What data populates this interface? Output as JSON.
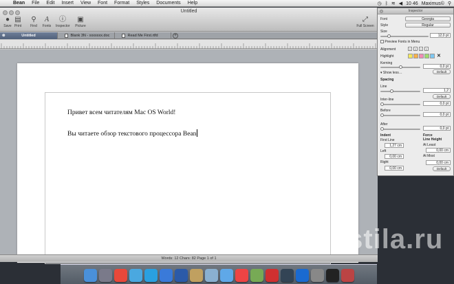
{
  "menubar": {
    "items": [
      "Bean",
      "File",
      "Edit",
      "Insert",
      "View",
      "Font",
      "Format",
      "Styles",
      "Documents",
      "Help"
    ],
    "clock": "10 46",
    "user": "Maximus©"
  },
  "window": {
    "title": "Untitled",
    "toolbar": {
      "save": "Save",
      "print": "Print",
      "find": "Find",
      "fonts": "Fonts",
      "inspector": "Inspector",
      "picture": "Picture",
      "fullscreen": "Full Screen"
    },
    "tabs": [
      {
        "label": "Untitled"
      },
      {
        "label": "Blank 3N - xxxxxxx.doc"
      },
      {
        "label": "Read Me First.rtfd"
      }
    ]
  },
  "document": {
    "lines": [
      "Привет всем читателям Mac OS World!",
      "Вы читаете обзор текстового процессора Bean"
    ]
  },
  "status": {
    "text": "Words: 12   Chars: 82   Page 1 of 1"
  },
  "inspector": {
    "title": "Inspector",
    "font_label": "Font",
    "font_value": "Georgia",
    "style_label": "Style",
    "style_value": "Regular",
    "size_label": "Size",
    "size_value": "12,0 pt",
    "preview_label": "Preview Fonts in Menu",
    "alignment_label": "Alignment",
    "highlight_label": "Highlight",
    "highlight_colors": [
      "#f5ea5a",
      "#f7b14a",
      "#f28bb5",
      "#9fdc6c",
      "#7ec8f2"
    ],
    "kerning_label": "Kerning",
    "kerning_value": "0,0 pt",
    "default_label": "Default",
    "show_less": "Show less…",
    "spacing_label": "Spacing",
    "line_label": "Line",
    "line_value": "1,2",
    "interline_label": "Inter-line",
    "interline_value": "0,0 pt",
    "before_label": "Before",
    "before_value": "0,0 pt",
    "after_label": "After",
    "after_value": "0,0 pt",
    "indent_label": "Indent",
    "force_label": "Force",
    "lineheight_label": "Line Height",
    "firstline_label": "First Line",
    "firstline_value": "1,27 cm",
    "atleast_label": "At Least",
    "left_label": "Left",
    "left_value": "0,00 cm",
    "atleast_value": "0,00 cm",
    "atmost_label": "At Most",
    "right_label": "Right",
    "right_value": "0,00 cm",
    "atmost_value": "0,00 cm"
  },
  "background_watermark": "Postila.ru",
  "dock": {
    "icons": [
      "finder-icon",
      "launchpad-icon",
      "chrome-icon",
      "twitter-icon",
      "skype-icon",
      "app-store-icon",
      "word-icon",
      "bean-icon",
      "preview-icon",
      "itunes-icon",
      "calendar-icon",
      "photo-icon",
      "adobe-icon",
      "lightroom-icon",
      "photoshop-icon",
      "system-prefs-icon",
      "terminal-icon",
      "photo-booth-icon"
    ]
  }
}
